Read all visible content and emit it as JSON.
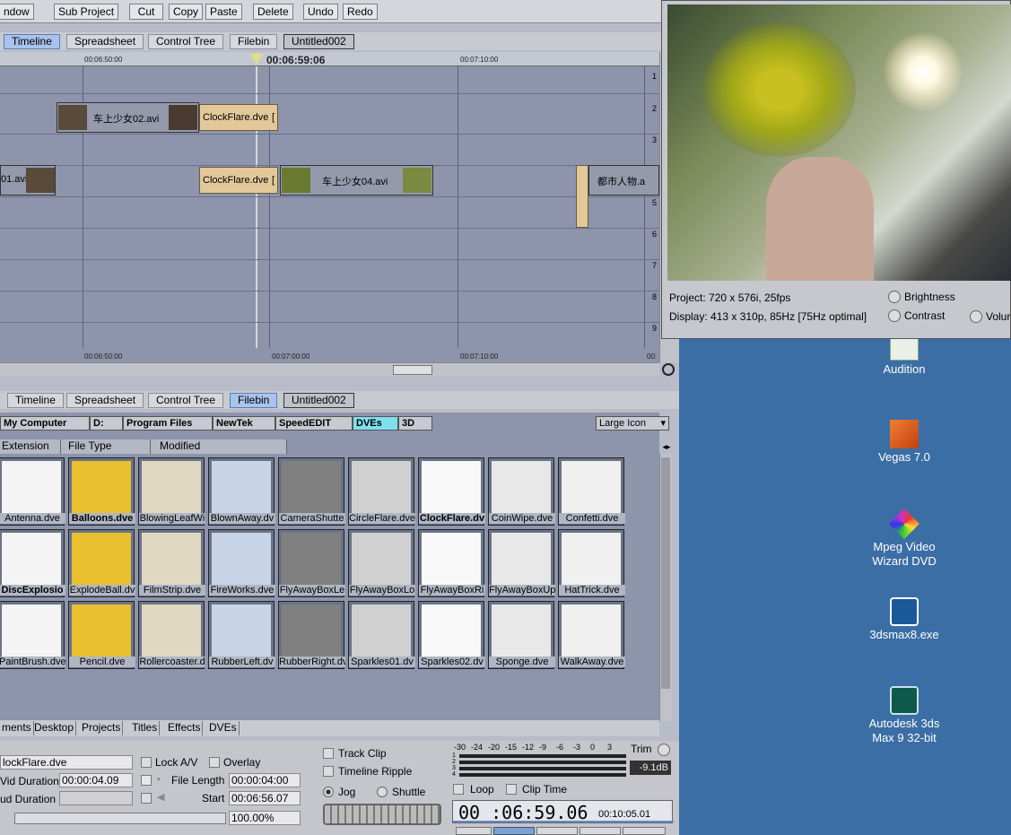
{
  "menu": {
    "items": [
      "ndow",
      "Sub Project",
      "Cut",
      "Copy",
      "Paste",
      "Delete",
      "Undo",
      "Redo"
    ]
  },
  "top_tabs": {
    "timeline": "Timeline",
    "spreadsheet": "Spreadsheet",
    "control_tree": "Control Tree",
    "filebin": "Filebin",
    "project": "Untitled002"
  },
  "timeline": {
    "ruler": {
      "t1": "00:06:50:00",
      "playhead": "00:06:59:06",
      "t3": "00:07:10:00"
    },
    "ruler_bottom": {
      "t1": "00:06:50:00",
      "t2": "00:07:00:00",
      "t3": "00:07:10:00",
      "t4": "00:"
    },
    "track_numbers": [
      "1",
      "2",
      "3",
      "4",
      "5",
      "6",
      "7",
      "8",
      "9"
    ],
    "clips": {
      "c1": "车上少女02.avi",
      "c2": "ClockFlare.dve",
      "c2_suffix": "[",
      "c3": "01.avi",
      "c4": "ClockFlare.dve",
      "c4_suffix": "[",
      "c5": "车上少女04.avi",
      "c6": "都市人物.a"
    }
  },
  "bin_tabs": {
    "timeline": "Timeline",
    "spreadsheet": "Spreadsheet",
    "control_tree": "Control Tree",
    "filebin": "Filebin",
    "project": "Untitled002"
  },
  "breadcrumb": [
    "My Computer",
    "D:",
    "Program Files",
    "NewTek",
    "SpeedEDIT",
    "DVEs",
    "3D"
  ],
  "view_mode": "Large Icon",
  "columns": {
    "extension": "Extension",
    "file_type": "File Type",
    "modified": "Modified"
  },
  "files": [
    {
      "name": "Antenna.dve",
      "bold": false
    },
    {
      "name": "Balloons.dve",
      "bold": true
    },
    {
      "name": "BlowingLeafWi",
      "bold": false
    },
    {
      "name": "BlownAway.dv",
      "bold": false
    },
    {
      "name": "CameraShutte",
      "bold": false
    },
    {
      "name": "CircleFlare.dve",
      "bold": false
    },
    {
      "name": "ClockFlare.dv",
      "bold": true
    },
    {
      "name": "CoinWipe.dve",
      "bold": false
    },
    {
      "name": "Confetti.dve",
      "bold": false
    },
    {
      "name": "DiscExplosio",
      "bold": true
    },
    {
      "name": "ExplodeBall.dv",
      "bold": false
    },
    {
      "name": "FilmStrip.dve",
      "bold": false
    },
    {
      "name": "FireWorks.dve",
      "bold": false
    },
    {
      "name": "FlyAwayBoxLe",
      "bold": false
    },
    {
      "name": "FlyAwayBoxLo",
      "bold": false
    },
    {
      "name": "FlyAwayBoxRi",
      "bold": false
    },
    {
      "name": "FlyAwayBoxUp",
      "bold": false
    },
    {
      "name": "HatTrick.dve",
      "bold": false
    },
    {
      "name": "PaintBrush.dve",
      "bold": false
    },
    {
      "name": "Pencil.dve",
      "bold": false
    },
    {
      "name": "Rollercoaster.d",
      "bold": false
    },
    {
      "name": "RubberLeft.dv",
      "bold": false
    },
    {
      "name": "RubberRight.dv",
      "bold": false
    },
    {
      "name": "Sparkles01.dv",
      "bold": false
    },
    {
      "name": "Sparkles02.dv",
      "bold": false
    },
    {
      "name": "Sponge.dve",
      "bold": false
    },
    {
      "name": "WalkAway.dve",
      "bold": false
    }
  ],
  "bottom_tabs": [
    "ments",
    "Desktop",
    "Projects",
    "Titles",
    "Effects",
    "DVEs"
  ],
  "props": {
    "clip_name": "lockFlare.dve",
    "vid_duration_label": "Vid Duration",
    "vid_duration": "00:00:04.09",
    "aud_duration_label": "ud Duration",
    "aud_duration": "",
    "lock_av": "Lock A/V",
    "overlay": "Overlay",
    "file_length_label": "File Length",
    "file_length": "00:00:04:00",
    "start_label": "Start",
    "start": "00:06:56.07",
    "zoom": "100.00%"
  },
  "transport": {
    "track_clip": "Track Clip",
    "timeline_ripple": "Timeline Ripple",
    "jog": "Jog",
    "shuttle": "Shuttle",
    "loop": "Loop",
    "clip_time": "Clip Time",
    "timecode": "00 :06:59.06",
    "duration": "00:10:05.01",
    "trim": "Trim",
    "db": "-9.1dB",
    "meter_scale": [
      "-30",
      "-24",
      "-20",
      "-15",
      "-12",
      "-9",
      "-6",
      "-3",
      "0",
      "3"
    ],
    "meter_channels": [
      "1",
      "2",
      "3",
      "4"
    ]
  },
  "preview": {
    "project_info": "Project: 720 x 576i, 25fps",
    "display_info": "Display: 413 x 310p, 85Hz [75Hz optimal]",
    "brightness": "Brightness",
    "contrast": "Contrast",
    "volume": "Volur"
  },
  "desktop": [
    {
      "label": "Audition"
    },
    {
      "label": "Vegas 7.0"
    },
    {
      "label": "Mpeg Video Wizard DVD"
    },
    {
      "label": "3dsmax8.exe"
    },
    {
      "label": "Autodesk 3ds Max 9 32-bit"
    }
  ],
  "colors": {
    "desktop": "#3b6ea5",
    "panel": "#8d94ab",
    "dve_clip": "#e3c89a",
    "active_tab": "#a9c3ec",
    "crumb_active": "#7ee0ee"
  }
}
